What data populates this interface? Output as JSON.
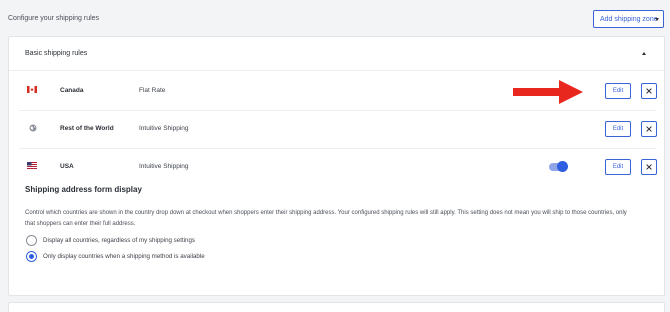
{
  "page": {
    "title": "Configure your shipping rules",
    "add_zone_label": "Add shipping zone"
  },
  "panel": {
    "title": "Basic shipping rules",
    "rows": [
      {
        "country": "Canada",
        "method": "Flat Rate",
        "edit_label": "Edit",
        "flag_icon": "canada-flag-icon"
      },
      {
        "country": "Rest of the World",
        "method": "Intuitive Shipping",
        "edit_label": "Edit",
        "flag_icon": "globe-icon"
      },
      {
        "country": "USA",
        "method": "Intuitive Shipping",
        "edit_label": "Edit",
        "flag_icon": "usa-flag-icon",
        "toggle_on": true
      }
    ]
  },
  "address_form": {
    "title": "Shipping address form display",
    "description": "Control which countries are shown in the country drop down at checkout when shoppers enter their shipping address. Your configured shipping rules will still apply. This setting does not mean you will ship to those countries, only that shoppers can enter their full address.",
    "options": [
      {
        "label": "Display all countries, regardless of my shipping settings",
        "checked": false
      },
      {
        "label": "Only display countries when a shipping method is available",
        "checked": true
      }
    ]
  },
  "colors": {
    "accent": "#3a63d8",
    "arrow": "#e8271f"
  }
}
